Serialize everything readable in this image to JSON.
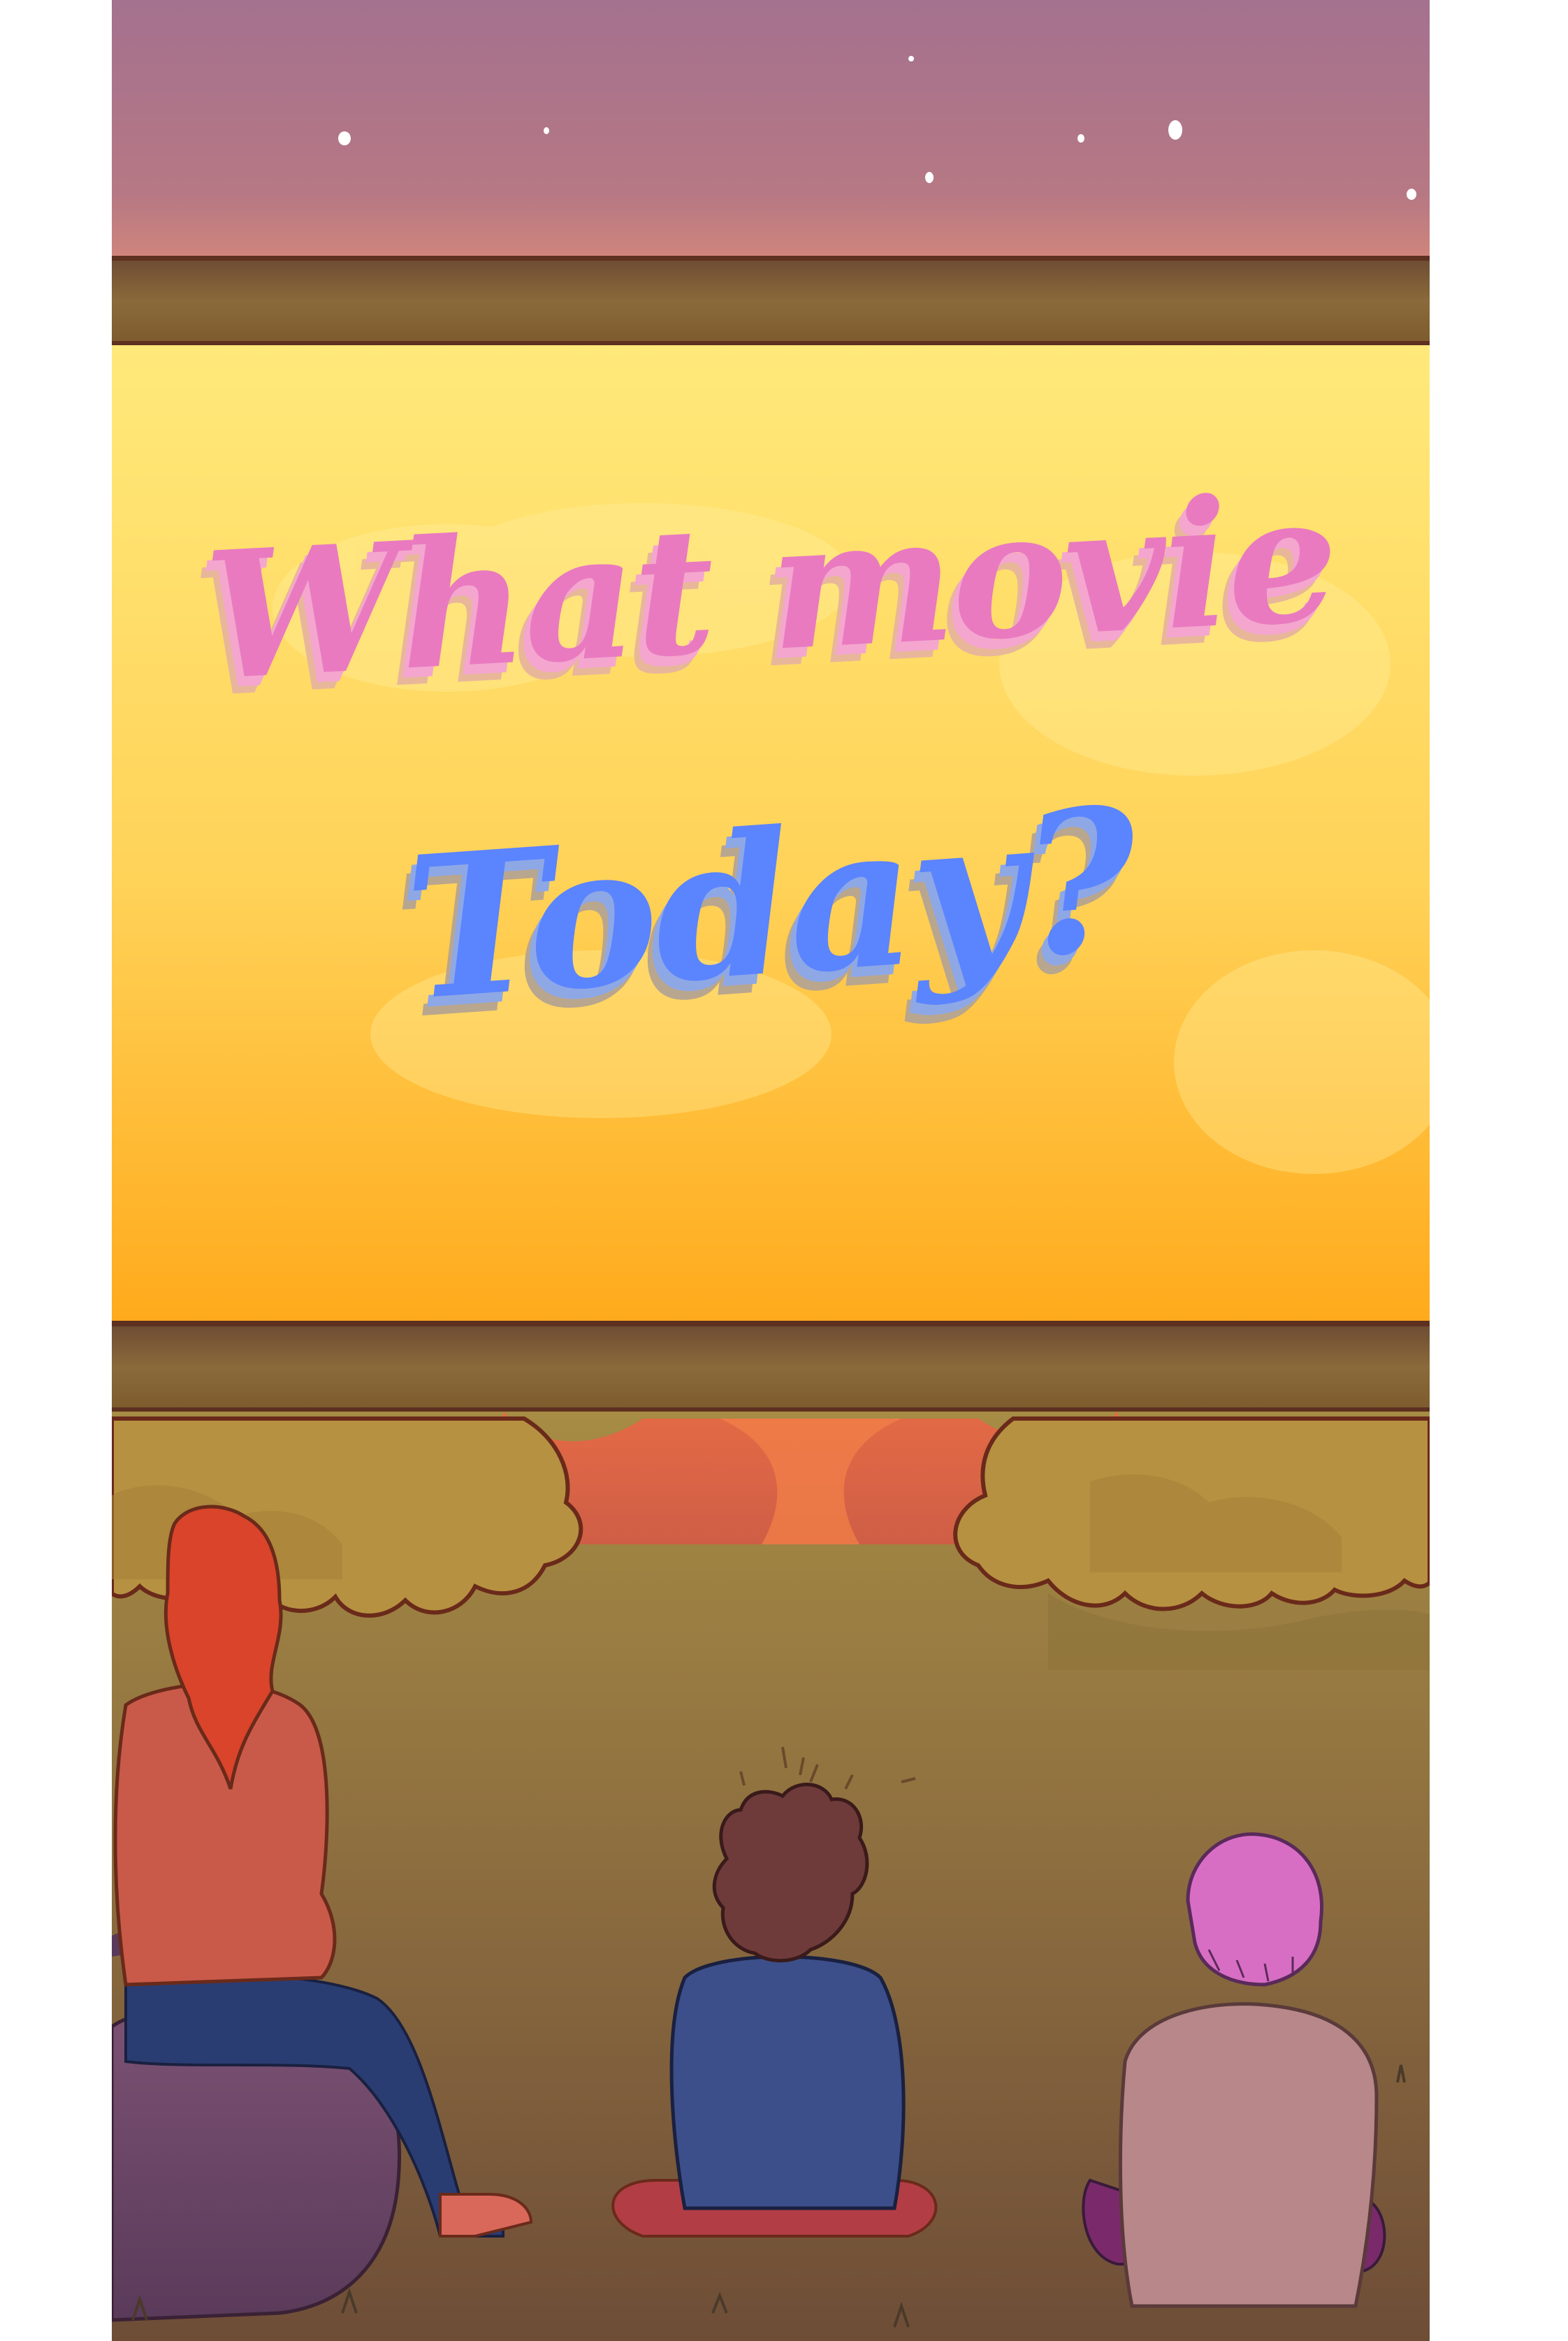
{
  "headline": {
    "line_1": "What movie",
    "line_2": "Today?"
  },
  "colors": {
    "sky_top": "#a4718f",
    "sky_bottom": "#d0857c",
    "screen_top": "#ffe97a",
    "screen_bottom": "#ffaa1c",
    "frame": "#806033",
    "ground": "#9a8040",
    "bushes": "#b69141",
    "line_1_text": "#e97ac0",
    "line_2_text": "#5b84ff"
  },
  "scene": {
    "setting": "outdoor-cinema-at-dusk",
    "viewers": [
      "red-haired-viewer-on-rock",
      "curly-haired-viewer",
      "pink-haired-viewer"
    ]
  }
}
